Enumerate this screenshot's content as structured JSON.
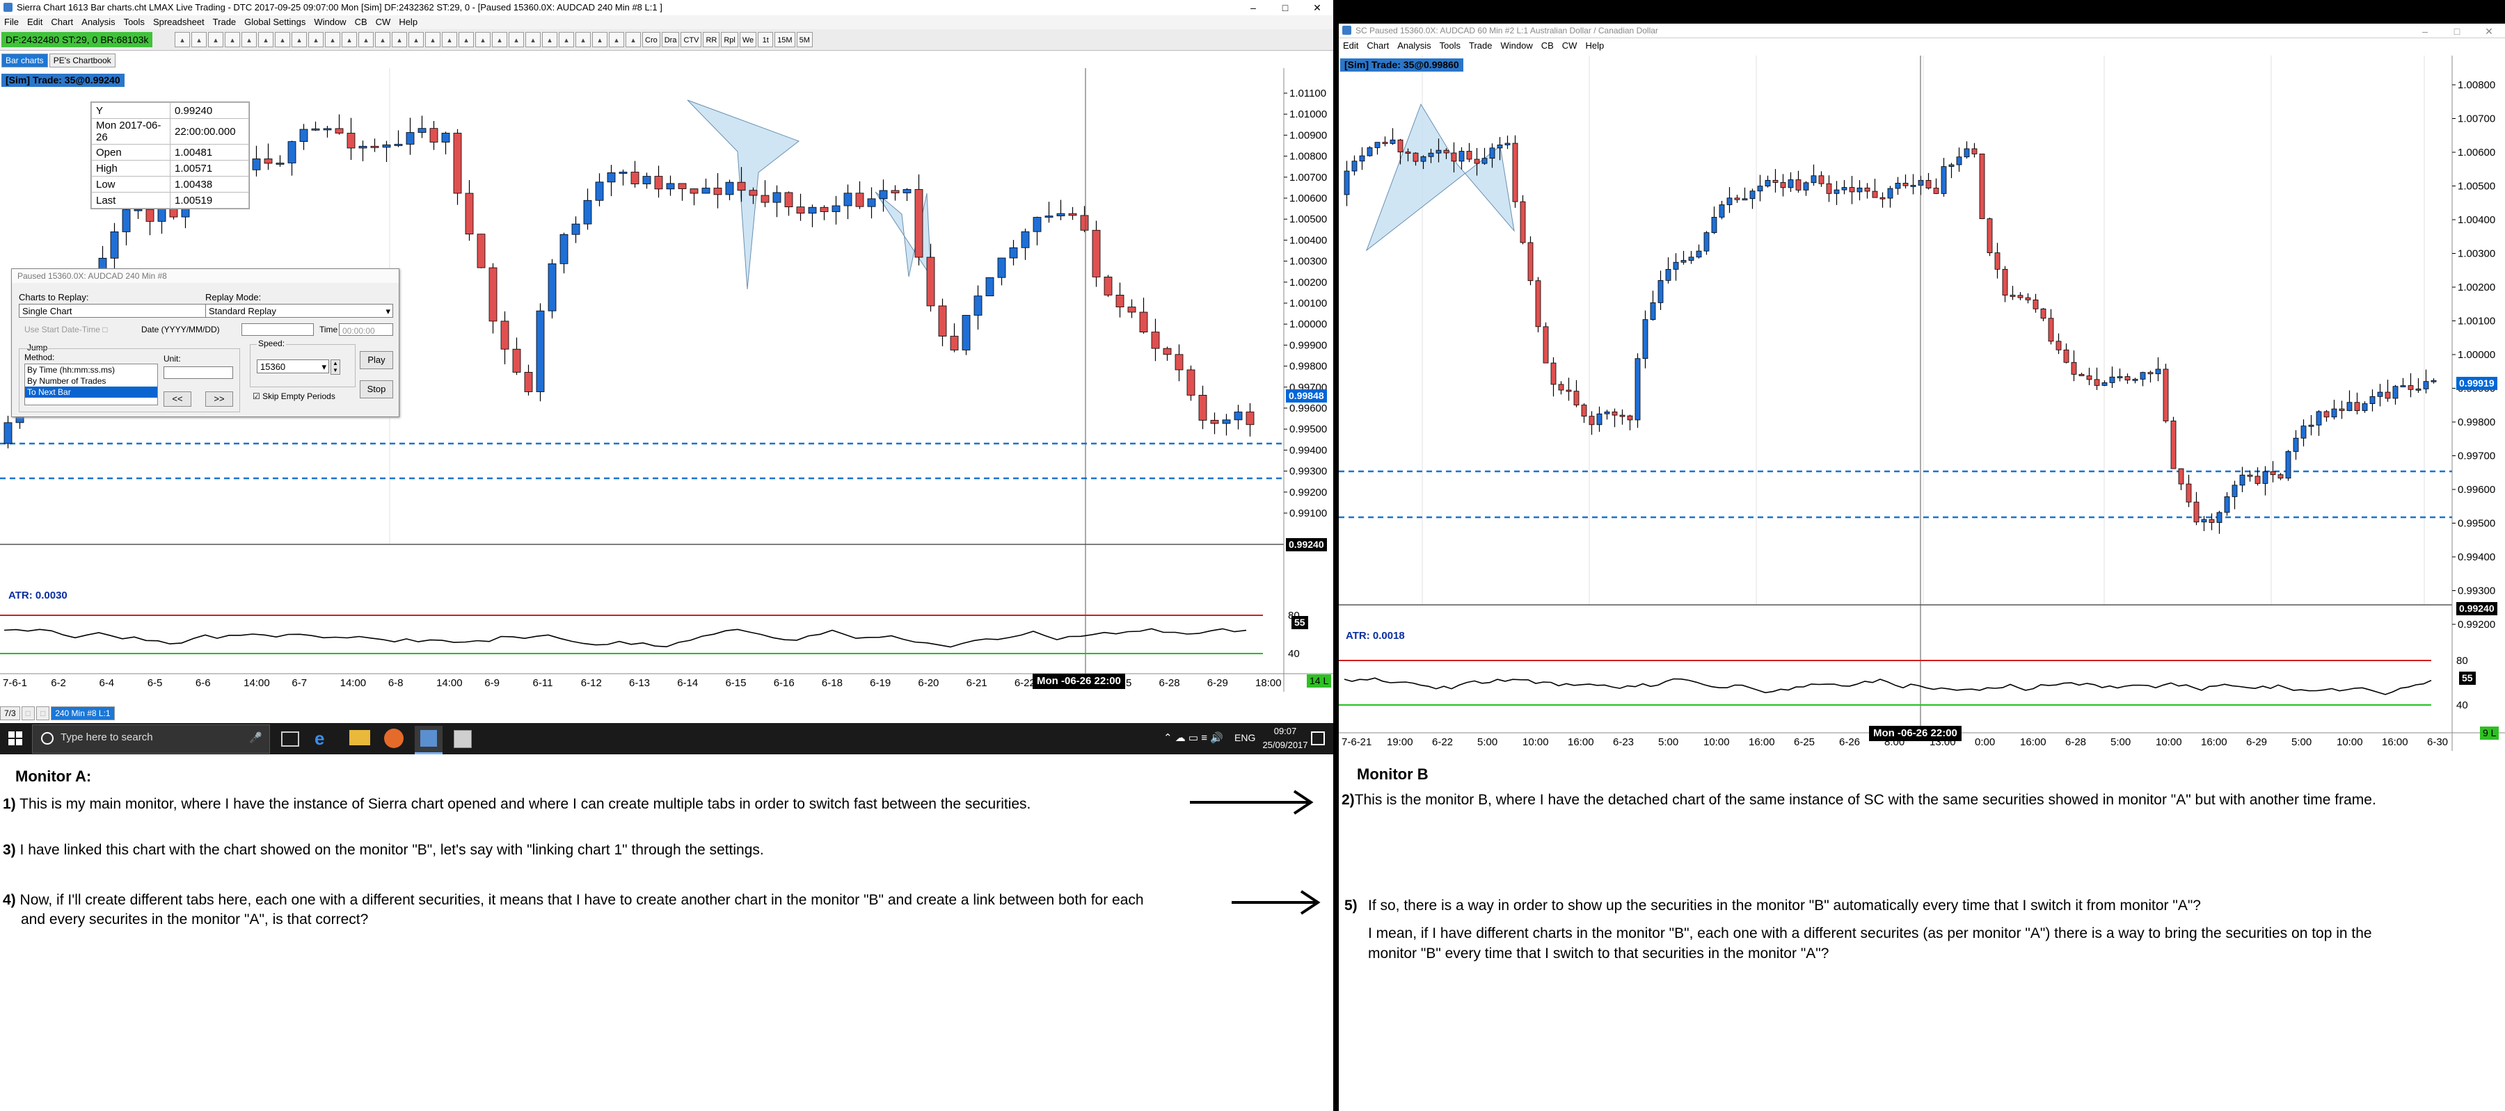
{
  "monitorA": {
    "window_title": "Sierra Chart 1613 Bar charts.cht  LMAX Live Trading - DTC 2017-09-25  09:07:00 Mon [Sim]  DF:2432362  ST:29, 0 - [Paused 15360.0X: AUDCAD  240 Min  #8  L:1 ]",
    "menu": [
      "File",
      "Edit",
      "Chart",
      "Analysis",
      "Tools",
      "Spreadsheet",
      "Trade",
      "Global Settings",
      "Window",
      "CB",
      "CW",
      "Help"
    ],
    "toolbar_buttons": [
      "Cro",
      "Dra",
      "CTV",
      "RR",
      "Rpl",
      "We",
      "1t",
      "15M",
      "5M"
    ],
    "status": "DF:2432480  ST:29, 0  BR:68103k",
    "tabs": [
      "Bar charts",
      "PE's Chartbook"
    ],
    "sim_label": "[Sim]  Trade: 35@0.99240",
    "info_box": [
      {
        "k": "Y",
        "v": "0.99240"
      },
      {
        "k": "Mon 2017-06-26",
        "v": "22:00:00.000"
      },
      {
        "k": "Open",
        "v": "1.00481"
      },
      {
        "k": "High",
        "v": "1.00571"
      },
      {
        "k": "Low",
        "v": "1.00438"
      },
      {
        "k": "Last",
        "v": "1.00519"
      }
    ],
    "replay": {
      "title": "Paused 15360.0X: AUDCAD  240 Min  #8",
      "charts_to_replay_label": "Charts to Replay:",
      "charts_to_replay_value": "Single Chart",
      "replay_mode_label": "Replay Mode:",
      "replay_mode_value": "Standard Replay",
      "use_start_label": "Use Start Date-Time",
      "date_label": "Date (YYYY/MM/DD)",
      "time_label": "Time",
      "time_value": "00:00:00",
      "jump_label": "Jump",
      "method_label": "Method:",
      "methods": [
        "By Time (hh:mm:ss.ms)",
        "By Number of Trades",
        "To Next Bar"
      ],
      "unit_label": "Unit:",
      "speed_label": "Speed:",
      "speed_value": "15360",
      "skip_label": "Skip Empty Periods",
      "prev_label": "<<",
      "next_label": ">>",
      "play_label": "Play",
      "stop_label": "Stop"
    },
    "price_ticks": [
      "1.01100",
      "1.01000",
      "1.00900",
      "1.00800",
      "1.00700",
      "1.00600",
      "1.00500",
      "1.00400",
      "1.00300",
      "1.00200",
      "1.00100",
      "1.00000",
      "0.99900",
      "0.99800",
      "0.99700",
      "0.99600",
      "0.99500",
      "0.99400",
      "0.99300",
      "0.99200",
      "0.99100"
    ],
    "current_price": "0.99848",
    "cursor_price": "0.99240",
    "atr_label": "ATR: 0.0030",
    "atr_ticks": [
      "80",
      "40"
    ],
    "atr_value": "55",
    "date_ticks": [
      "7-6-1",
      "6-2",
      "6-4",
      "6-5",
      "6-6",
      "14:00",
      "6-7",
      "14:00",
      "6-8",
      "14:00",
      "6-9",
      "6-11",
      "6-12",
      "6-13",
      "6-14",
      "6-15",
      "6-16",
      "6-18",
      "6-19",
      "6-20",
      "6-21",
      "6-22",
      "6-23",
      "6-25",
      "6-28",
      "6-29",
      "18:00"
    ],
    "date_hover": "Mon -06-26  22:00",
    "bottom_badge": "14 L",
    "bottom_tabs": [
      "7/3",
      "240 Min  #8  L:1"
    ],
    "taskbar": {
      "search_placeholder": "Type here to search",
      "lang": "ENG",
      "time": "09:07",
      "date": "25/09/2017"
    }
  },
  "monitorB": {
    "window_title": "SC  Paused 15360.0X: AUDCAD  60 Min  #2  L:1  Australian Dollar / Canadian Dollar",
    "menu": [
      "Edit",
      "Chart",
      "Analysis",
      "Tools",
      "Trade",
      "Window",
      "CB",
      "CW",
      "Help"
    ],
    "sim_label": "[Sim]  Trade: 35@0.99860",
    "price_ticks": [
      "1.00800",
      "1.00700",
      "1.00600",
      "1.00500",
      "1.00400",
      "1.00300",
      "1.00200",
      "1.00100",
      "1.00000",
      "0.99900",
      "0.99800",
      "0.99700",
      "0.99600",
      "0.99500",
      "0.99400",
      "0.99300",
      "0.99200"
    ],
    "current_price": "0.99919",
    "cursor_price": "0.99240",
    "atr_label": "ATR: 0.0018",
    "atr_ticks": [
      "80",
      "40"
    ],
    "atr_value": "55",
    "date_ticks": [
      "7-6-21",
      "19:00",
      "6-22",
      "5:00",
      "10:00",
      "16:00",
      "6-23",
      "5:00",
      "10:00",
      "16:00",
      "6-25",
      "6-26",
      "8:00",
      "13:00",
      "0:00",
      "16:00",
      "6-28",
      "5:00",
      "10:00",
      "16:00",
      "6-29",
      "5:00",
      "10:00",
      "16:00",
      "6-30"
    ],
    "date_hover": "Mon -06-26  22:00",
    "bottom_badge": "9 L"
  },
  "text": {
    "monitor_a_heading": "Monitor A:",
    "a1_num": "1)",
    "a1": "This is my main monitor, where I have the instance of Sierra chart opened and where I can create multiple tabs in order to switch fast between the securities.",
    "a3_num": "3)",
    "a3": "I have linked this chart with the chart showed on the monitor \"B\", let's say with \"linking chart 1\" through the settings.",
    "a4_num": "4)",
    "a4_line1": "Now, if I'll create different tabs here, each one with a different securities, it means that I have to create another chart in the monitor \"B\" and create a link between both for each",
    "a4_line2": "and every securites in the monitor \"A\", is that correct?",
    "monitor_b_heading": "Monitor B",
    "b2_num": "2)",
    "b2": "This is the monitor B, where I have the detached chart of the same instance of SC with the same securities showed in monitor \"A\" but with another time frame.",
    "b5_num": "5)",
    "b5_line1": "If so, there is a way in order to show up the securities in the monitor \"B\" automatically every time that I switch it from monitor \"A\"?",
    "b5_line2": "I mean, if I have different charts in the monitor \"B\", each one with a different securites (as per monitor \"A\") there is a way to bring the securities on top in the",
    "b5_line3": "monitor \"B\" every time that I switch to that securities in the monitor \"A\"?"
  },
  "colors": {
    "up_candle": "#1f6fd6",
    "down_candle": "#e05050",
    "dashed_level": "#1a73d0",
    "harmonic_fill": "#bfdcf0",
    "atr_red": "#d21e1e",
    "atr_green": "#1fc21f"
  }
}
